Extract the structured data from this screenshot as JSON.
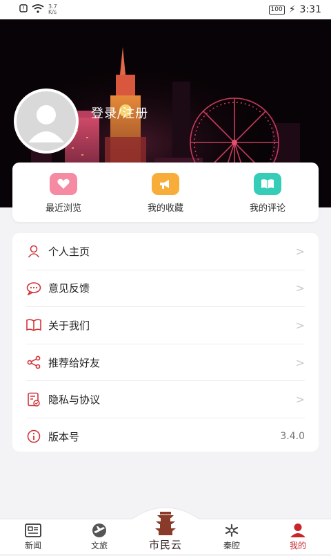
{
  "status": {
    "speed_value": "3.7",
    "speed_unit": "K/s",
    "battery": "100",
    "time": "3:31"
  },
  "profile": {
    "login_label": "登录/注册"
  },
  "quick": [
    {
      "label": "最近浏览",
      "color": "#f58aa2"
    },
    {
      "label": "我的收藏",
      "color": "#f8ad3b"
    },
    {
      "label": "我的评论",
      "color": "#35cdb8"
    }
  ],
  "menu": [
    {
      "label": "个人主页",
      "icon": "person-icon"
    },
    {
      "label": "意见反馈",
      "icon": "feedback-icon"
    },
    {
      "label": "关于我们",
      "icon": "book-icon"
    },
    {
      "label": "推荐给好友",
      "icon": "share-icon"
    },
    {
      "label": "隐私与协议",
      "icon": "privacy-icon"
    },
    {
      "label": "版本号",
      "icon": "info-icon",
      "value": "3.4.0"
    }
  ],
  "chevron": ">",
  "tabs": [
    {
      "label": "新闻",
      "icon": "news-icon"
    },
    {
      "label": "文旅",
      "icon": "travel-icon"
    },
    {
      "label": "市民云",
      "icon": "citizen-cloud-logo"
    },
    {
      "label": "秦腔",
      "icon": "opera-icon"
    },
    {
      "label": "我的",
      "icon": "profile-icon",
      "active": true
    }
  ],
  "colors": {
    "accent": "#c8242b",
    "menu_icon": "#d0343b"
  }
}
